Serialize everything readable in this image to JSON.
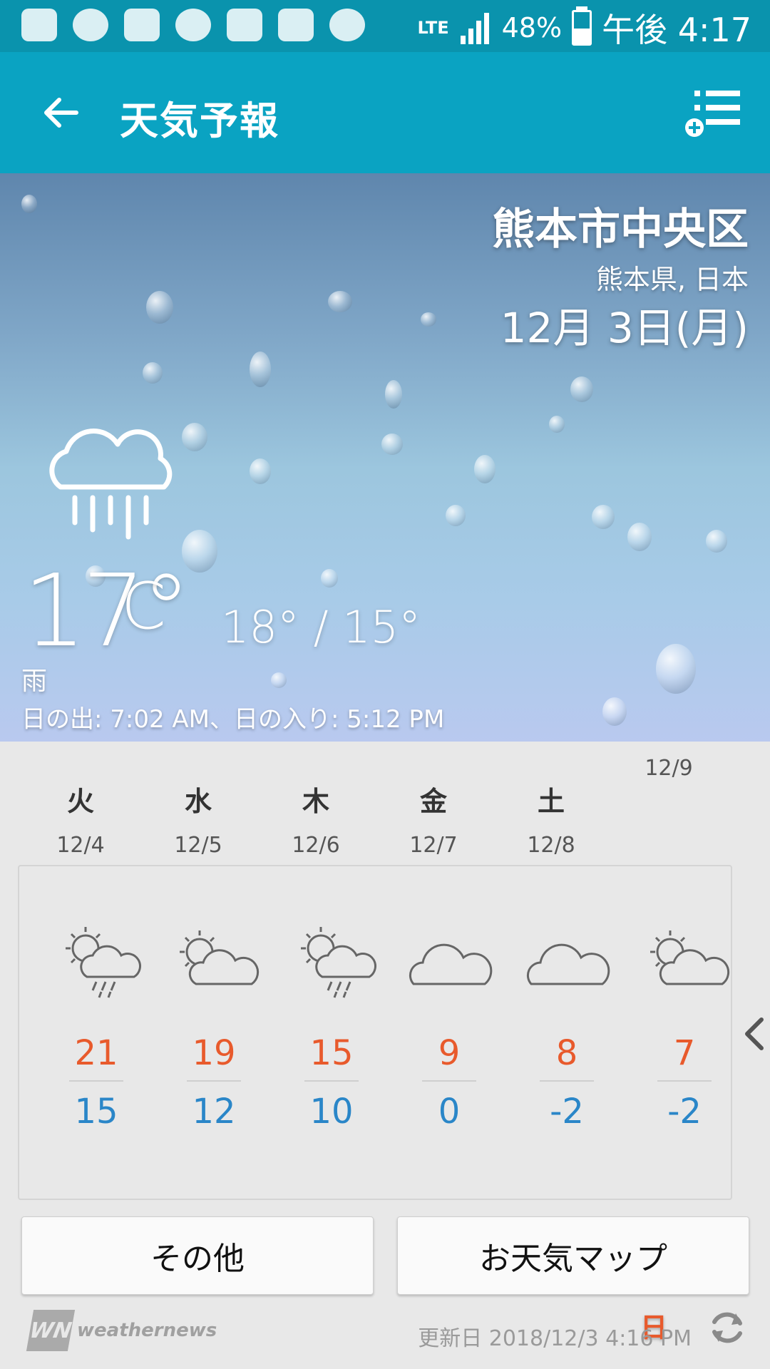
{
  "status_bar": {
    "network": "LTE",
    "battery": "48%",
    "time": "午後 4:17",
    "battery_level": 0.48,
    "notification_icons": [
      "message-icon",
      "line-icon",
      "youtube-icon",
      "mascot-icon",
      "mail-icon",
      "app-icon",
      "mascot-icon",
      "mascot-icon"
    ]
  },
  "app_bar": {
    "title": "天気予報"
  },
  "current": {
    "city": "熊本市中央区",
    "prefecture": "熊本県, 日本",
    "date": "12月 3日(月)",
    "temp": "17°",
    "unit": "C",
    "hilo": "18° / 15°",
    "condition": "雨",
    "sun": "日の出: 7:02  AM、日の入り: 5:12  PM"
  },
  "forecast": [
    {
      "dow": "火",
      "date": "12/4",
      "hi": "21",
      "lo": "15",
      "icon": "sun-cloud-rain-icon"
    },
    {
      "dow": "水",
      "date": "12/5",
      "hi": "19",
      "lo": "12",
      "icon": "sun-cloud-icon"
    },
    {
      "dow": "木",
      "date": "12/6",
      "hi": "15",
      "lo": "10",
      "icon": "sun-cloud-rain-icon"
    },
    {
      "dow": "金",
      "date": "12/7",
      "hi": "9",
      "lo": "0",
      "icon": "cloud-icon"
    },
    {
      "dow": "土",
      "date": "12/8",
      "hi": "8",
      "lo": "-2",
      "icon": "cloud-icon"
    },
    {
      "dow": "日",
      "date": "12/9",
      "hi": "7",
      "lo": "-2",
      "icon": "sun-cloud-icon"
    }
  ],
  "buttons": {
    "other": "その他",
    "map": "お天気マップ"
  },
  "footer": {
    "brand": "weathernews",
    "logo_text": "WN",
    "updated": "更新日 2018/12/3 4:16 PM"
  },
  "colors": {
    "appbar": "#0aa3c2",
    "statusbar": "#0a93ad",
    "high": "#e85a2c",
    "low": "#2a86c8"
  }
}
